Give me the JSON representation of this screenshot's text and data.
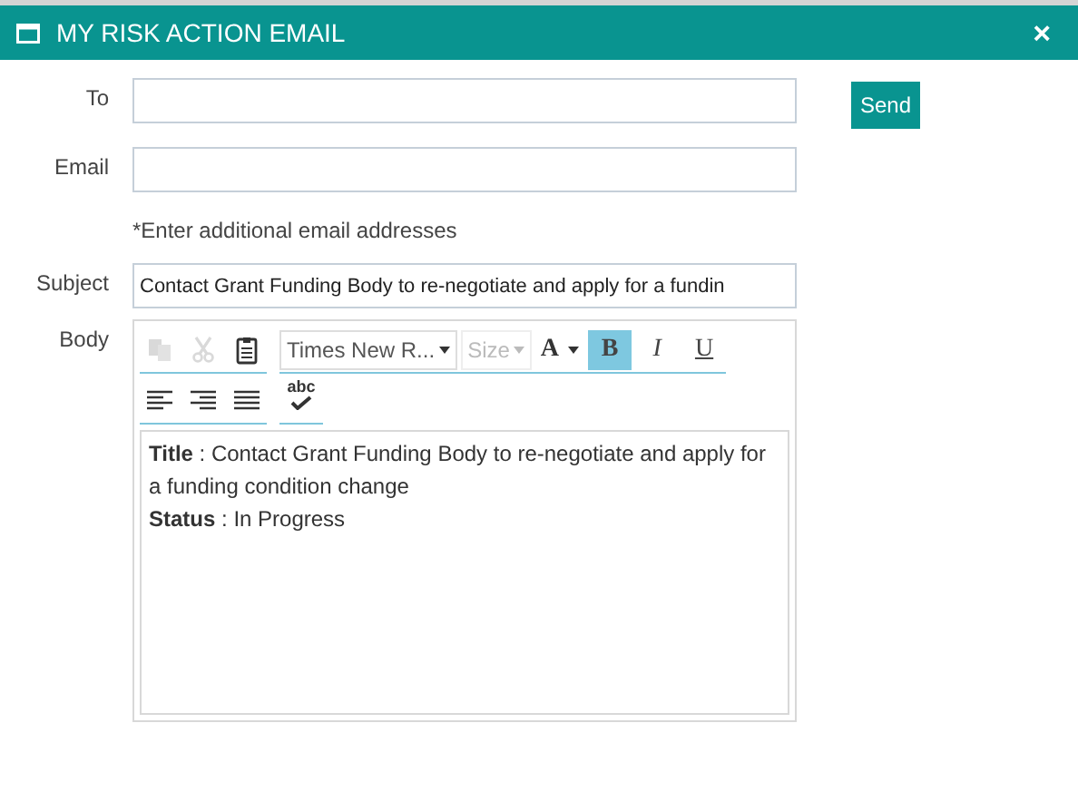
{
  "window": {
    "title": "MY RISK ACTION EMAIL",
    "close": "×"
  },
  "fields": [
    {
      "label": "To"
    },
    {
      "label": "Email",
      "hint": "*Enter additional email addresses"
    },
    {
      "label": "Subject",
      "value": "Contact Grant Funding Body to re-negotiate and apply for a fundin"
    }
  ],
  "send_button": "Send",
  "body_label": "Body",
  "toolbar": [
    [
      {
        "kind": "copy",
        "disabled": true
      },
      {
        "kind": "cut",
        "disabled": true
      },
      {
        "kind": "paste",
        "disabled": false
      }
    ],
    [
      {
        "kind": "dropdown",
        "label": "Times New R...",
        "disabled": false
      },
      {
        "kind": "dropdown",
        "label": "Size",
        "disabled": true
      },
      {
        "kind": "color",
        "label": "A",
        "disabled": false
      },
      {
        "kind": "bold",
        "label": "B",
        "selected": true
      },
      {
        "kind": "italic",
        "label": "I",
        "selected": false
      },
      {
        "kind": "underline",
        "label": "U",
        "selected": false
      }
    ],
    [
      {
        "kind": "align-left",
        "disabled": false
      },
      {
        "kind": "align-right",
        "disabled": false
      },
      {
        "kind": "justify",
        "disabled": false
      }
    ],
    [
      {
        "kind": "spellcheck",
        "label": "abc",
        "disabled": false
      }
    ]
  ],
  "body": [
    "**Title** : Contact Grant Funding Body to re-negotiate and apply for a funding condition change",
    "**Status** : In Progress"
  ]
}
